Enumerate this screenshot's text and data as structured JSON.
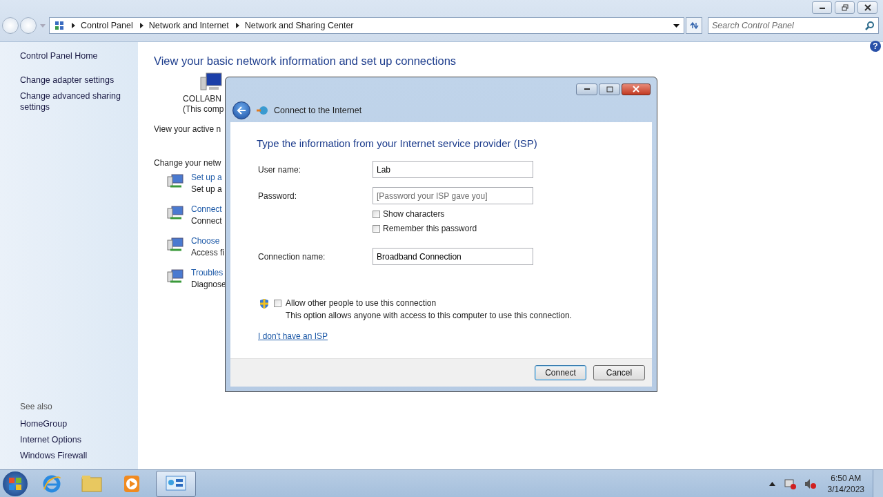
{
  "address_bar": {
    "crumbs": [
      "Control Panel",
      "Network and Internet",
      "Network and Sharing Center"
    ]
  },
  "search": {
    "placeholder": "Search Control Panel"
  },
  "sidebar": {
    "items": [
      "Control Panel Home",
      "Change adapter settings",
      "Change advanced sharing settings"
    ],
    "see_also_heading": "See also",
    "see_also": [
      "HomeGroup",
      "Internet Options",
      "Windows Firewall"
    ]
  },
  "main": {
    "help": "?",
    "heading": "View your basic network information and set up connections",
    "computer_name": "COLLABN",
    "computer_note": "(This comp",
    "active_networks": "View your active n",
    "change_heading": "Change your netw",
    "tasks": [
      {
        "link": "Set up a",
        "description": "Set up a"
      },
      {
        "link": "Connect",
        "description": "Connect"
      },
      {
        "link": "Choose",
        "description": "Access fi"
      },
      {
        "link": "Troubles",
        "description": "Diagnose"
      }
    ]
  },
  "dialog": {
    "title": "Connect to the Internet",
    "heading": "Type the information from your Internet service provider (ISP)",
    "fields": [
      {
        "label": "User name:",
        "value": "Lab"
      },
      {
        "label": "Password:",
        "placeholder": "[Password your ISP gave you]"
      }
    ],
    "options": [
      {
        "label": "Show characters",
        "checked": false
      },
      {
        "label": "Remember this password",
        "checked": false
      }
    ],
    "connection": {
      "label": "Connection name:",
      "value": "Broadband Connection"
    },
    "allow": {
      "label": "Allow other people to use this connection",
      "checked": false,
      "note": "This option allows anyone with access to this computer to use this connection."
    },
    "link": "I don't have an ISP",
    "buttons": [
      {
        "label": "Connect",
        "default": true
      },
      {
        "label": "Cancel",
        "default": false
      }
    ]
  },
  "taskbar": {
    "time": "6:50 AM",
    "date": "3/14/2023"
  }
}
